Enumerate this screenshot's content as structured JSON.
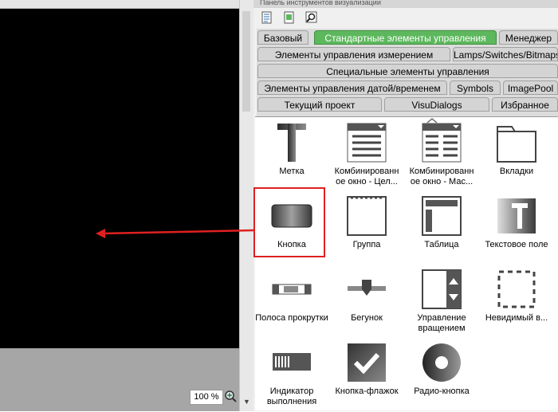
{
  "panel": {
    "title": "Панель инструментов визуализации",
    "tabs": {
      "row1": [
        "Базовый",
        "Стандартные элементы управления",
        "Менеджер"
      ],
      "row2": [
        "Элементы управления измерением",
        "Lamps/Switches/Bitmaps"
      ],
      "row3": [
        "Специальные элементы управления"
      ],
      "row4": [
        "Элементы управления датой/временем",
        "Symbols",
        "ImagePool"
      ],
      "row5": [
        "Текущий проект",
        "VisuDialogs",
        "Избранное"
      ]
    },
    "active_tab": "Стандартные элементы управления",
    "items": [
      {
        "label": "Метка",
        "icon": "label-t-icon"
      },
      {
        "label": "Комбинированн ое окно - Цел...",
        "icon": "combobox-integer-icon"
      },
      {
        "label": "Комбинированн ое окно - Мас...",
        "icon": "combobox-array-icon"
      },
      {
        "label": "Вкладки",
        "icon": "tabs-folder-icon"
      },
      {
        "label": "Кнопка",
        "icon": "button-icon"
      },
      {
        "label": "Группа",
        "icon": "group-frame-icon"
      },
      {
        "label": "Таблица",
        "icon": "table-icon"
      },
      {
        "label": "Текстовое поле",
        "icon": "text-field-icon"
      },
      {
        "label": "Полоса прокрутки",
        "icon": "scrollbar-icon"
      },
      {
        "label": "Бегунок",
        "icon": "slider-icon"
      },
      {
        "label": "Управление вращением",
        "icon": "spin-control-icon"
      },
      {
        "label": "Невидимый в...",
        "icon": "invisible-input-icon"
      },
      {
        "label": "Индикатор выполнения",
        "icon": "progress-bar-icon"
      },
      {
        "label": "Кнопка-флажок",
        "icon": "checkbox-icon"
      },
      {
        "label": "Радио-кнопка",
        "icon": "radio-button-icon"
      }
    ]
  },
  "editor": {
    "zoom": "100 %"
  },
  "colors": {
    "active_tab": "#5db85d",
    "highlight": "#e02020"
  }
}
